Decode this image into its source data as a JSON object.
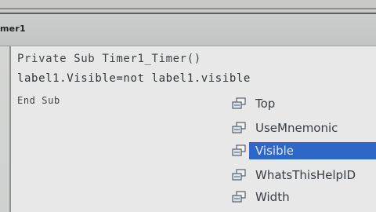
{
  "window": {
    "title": "mer1"
  },
  "code": {
    "lines": [
      "Private Sub Timer1_Timer()",
      "label1.Visible=not label1.visible",
      "End Sub"
    ]
  },
  "autocomplete": {
    "selected_color": "#2f67c9",
    "items": [
      {
        "label": "Top",
        "icon": "property-icon"
      },
      {
        "label": "UseMnemonic",
        "icon": "property-icon"
      },
      {
        "label": "Visible",
        "icon": "property-icon"
      },
      {
        "label": "WhatsThisHelpID",
        "icon": "property-icon"
      },
      {
        "label": "Width",
        "icon": "property-icon"
      }
    ]
  }
}
